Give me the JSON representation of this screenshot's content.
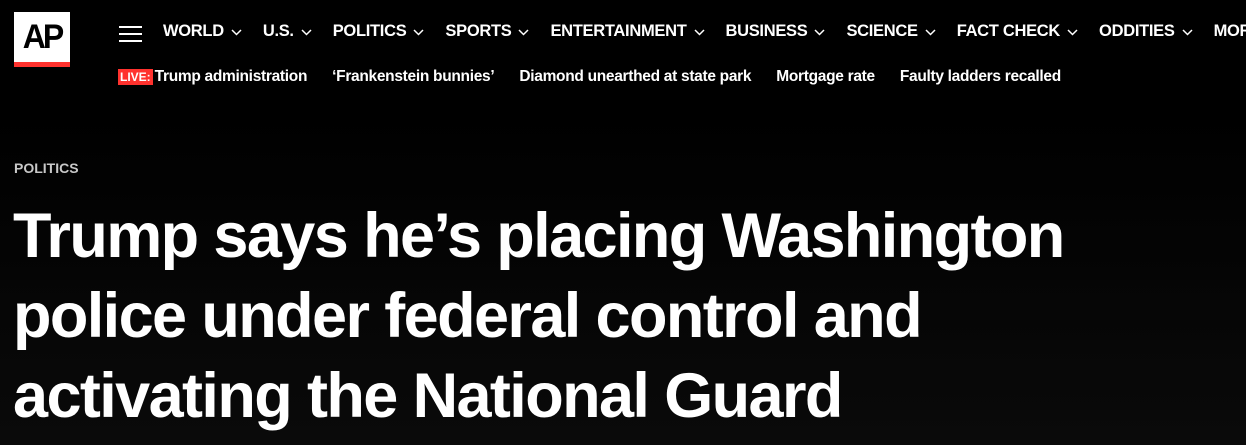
{
  "logo": {
    "text": "AP",
    "accent_color": "#ff322e"
  },
  "nav": {
    "items": [
      {
        "label": "WORLD"
      },
      {
        "label": "U.S."
      },
      {
        "label": "POLITICS"
      },
      {
        "label": "SPORTS"
      },
      {
        "label": "ENTERTAINMENT"
      },
      {
        "label": "BUSINESS"
      },
      {
        "label": "SCIENCE"
      },
      {
        "label": "FACT CHECK"
      },
      {
        "label": "ODDITIES"
      },
      {
        "label": "MORE"
      }
    ],
    "chevron_icon": "chevron-down-icon",
    "menu_icon": "hamburger-menu-icon"
  },
  "trending": {
    "live_badge": "LIVE:",
    "links": [
      {
        "label": "Trump administration"
      },
      {
        "label": "‘Frankenstein bunnies’"
      },
      {
        "label": "Diamond unearthed at state park"
      },
      {
        "label": "Mortgage rate"
      },
      {
        "label": "Faulty ladders recalled"
      }
    ]
  },
  "article": {
    "kicker": "POLITICS",
    "headline": "Trump says he’s placing Washington police under federal control and activating the National Guard"
  },
  "colors": {
    "background": "#000000",
    "live_red": "#ff322e",
    "text": "#ffffff"
  }
}
